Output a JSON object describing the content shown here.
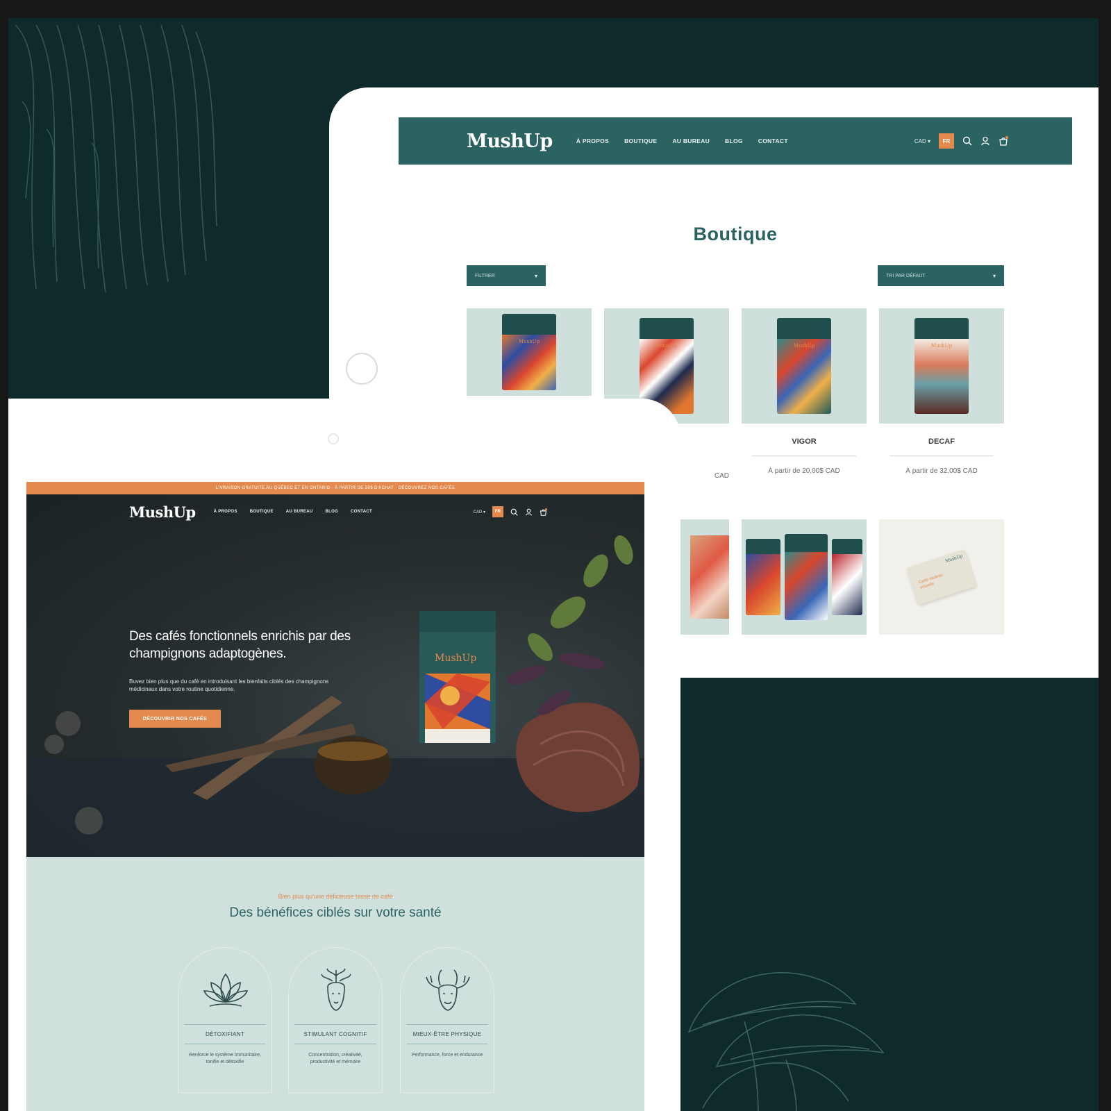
{
  "colors": {
    "teal": "#2b6262",
    "orange": "#e58a4e",
    "dark_bg": "#0f2a2a",
    "mint": "#cfe0dd"
  },
  "shop": {
    "brand": "MushUp",
    "nav": [
      "À PROPOS",
      "BOUTIQUE",
      "AU BUREAU",
      "BLOG",
      "CONTACT"
    ],
    "currency": "CAD ▾",
    "lang": "FR",
    "title": "Boutique",
    "filter_label": "FILTRER",
    "sort_label": "TRI PAR DÉFAUT",
    "products": [
      {
        "name": "",
        "price": ""
      },
      {
        "name": "",
        "price": "CAD"
      },
      {
        "name": "VIGOR",
        "price": "À partir de 20,00$ CAD"
      },
      {
        "name": "DECAF",
        "price": "À partir de 32,00$ CAD"
      }
    ],
    "gift_card": {
      "brand": "MushUp",
      "text": "Carte-cadeau virtuelle"
    }
  },
  "home": {
    "promo": "LIVRAISON GRATUITE AU QUÉBEC ET EN ONTARIO · À PARTIR DE 50$ D'ACHAT · DÉCOUVREZ NOS CAFÉS",
    "brand": "MushUp",
    "nav": [
      "À PROPOS",
      "BOUTIQUE",
      "AU BUREAU",
      "BLOG",
      "CONTACT"
    ],
    "currency": "CAD ▾",
    "lang": "FR",
    "hero_title": "Des cafés fonctionnels enrichis par des champignons adaptogènes.",
    "hero_sub": "Buvez bien plus que du café en introduisant les bienfaits ciblés des champignons médicinaux dans votre routine quotidienne.",
    "hero_cta": "DÉCOUVRIR NOS CAFÉS",
    "tin_brand": "MushUp",
    "benefits_eyebrow": "Bien plus qu'une délicieuse tasse de café",
    "benefits_title": "Des bénéfices ciblés sur votre santé",
    "cards": [
      {
        "icon": "lotus-icon",
        "name": "DÉTOXIFIANT",
        "desc": "Renforce le système immunitaire, tonifie et détoxifie"
      },
      {
        "icon": "face-sprout-icon",
        "name": "STIMULANT COGNITIF",
        "desc": "Concentration, créativité, productivité et mémoire"
      },
      {
        "icon": "stag-icon",
        "name": "MIEUX-ÊTRE PHYSIQUE",
        "desc": "Performance, force et endurance"
      }
    ]
  }
}
